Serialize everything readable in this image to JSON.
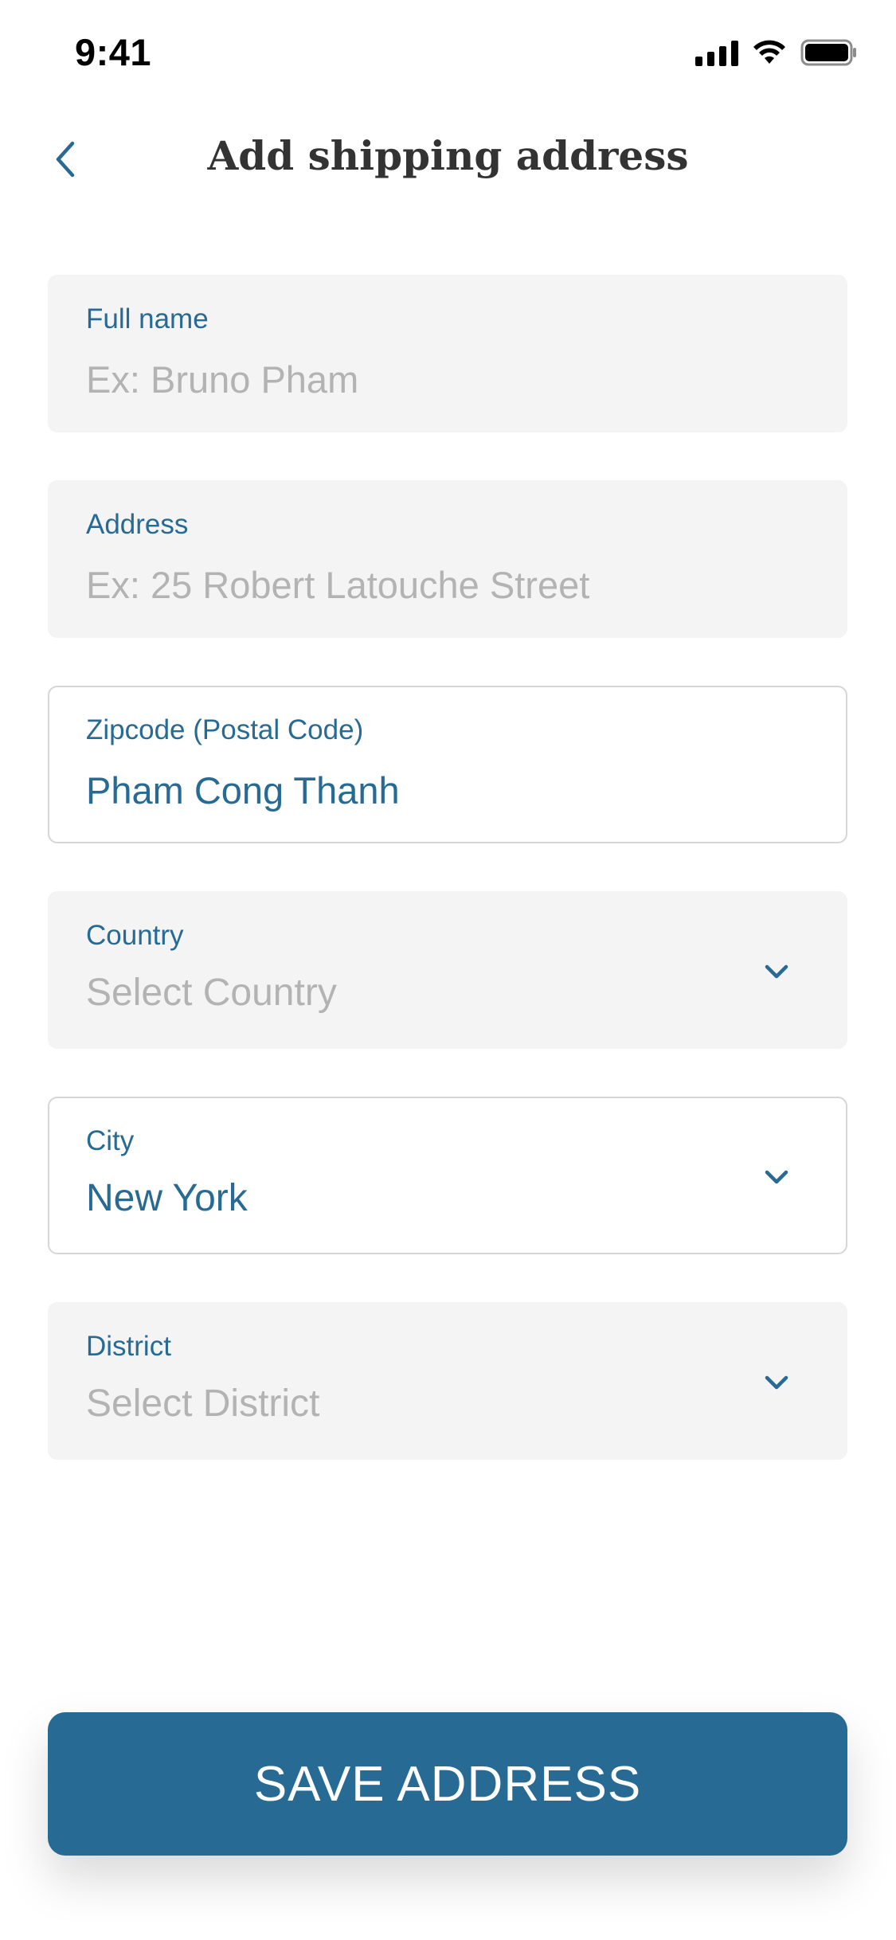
{
  "status_bar": {
    "time": "9:41"
  },
  "header": {
    "title": "Add shipping address",
    "back_icon": "chevron-left-icon"
  },
  "colors": {
    "accent": "#276a93",
    "field_bg": "#f4f4f4",
    "placeholder": "#b3b3b3",
    "title": "#333333"
  },
  "form": {
    "full_name": {
      "label": "Full name",
      "value": "",
      "placeholder": "Ex: Bruno Pham"
    },
    "address": {
      "label": "Address",
      "value": "",
      "placeholder": "Ex: 25 Robert Latouche Street"
    },
    "zipcode": {
      "label": "Zipcode (Postal Code)",
      "value": "Pham Cong Thanh",
      "placeholder": ""
    },
    "country": {
      "label": "Country",
      "value": "Select Country",
      "is_placeholder": true
    },
    "city": {
      "label": "City",
      "value": "New York",
      "is_placeholder": false
    },
    "district": {
      "label": "District",
      "value": "Select District",
      "is_placeholder": true
    }
  },
  "save_button": {
    "label": "SAVE ADDRESS"
  }
}
